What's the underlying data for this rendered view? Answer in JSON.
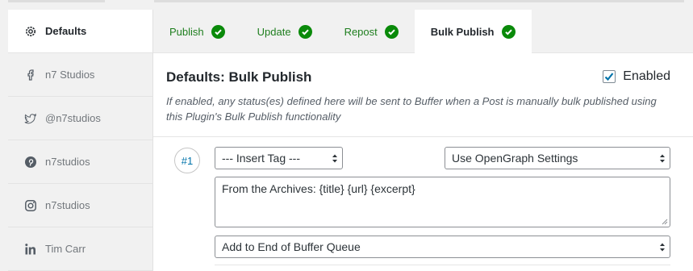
{
  "sidebar": {
    "items": [
      {
        "label": "Defaults",
        "icon": "gear-icon",
        "active": true
      },
      {
        "label": "n7 Studios",
        "icon": "facebook-icon",
        "active": false
      },
      {
        "label": "@n7studios",
        "icon": "twitter-icon",
        "active": false
      },
      {
        "label": "n7studios",
        "icon": "pinterest-icon",
        "active": false
      },
      {
        "label": "n7studios",
        "icon": "instagram-icon",
        "active": false
      },
      {
        "label": "Tim Carr",
        "icon": "linkedin-icon",
        "active": false
      }
    ]
  },
  "tabs": [
    {
      "label": "Publish",
      "icon": "check-circle-icon"
    },
    {
      "label": "Update",
      "icon": "check-circle-icon"
    },
    {
      "label": "Repost",
      "icon": "check-circle-icon"
    },
    {
      "label": "Bulk Publish",
      "icon": "check-circle-icon",
      "active": true
    }
  ],
  "panel": {
    "title": "Defaults: Bulk Publish",
    "enabled_label": "Enabled",
    "enabled_checked": true,
    "description": "If enabled, any status(es) defined here will be sent to Buffer when a Post is manually bulk published using this Plugin's Bulk Publish functionality"
  },
  "status": {
    "number": "#1",
    "tag_select": "--- Insert Tag ---",
    "image_select": "Use OpenGraph Settings",
    "text": "From the Archives: {title} {url} {excerpt}",
    "queue_select": "Add to End of Buffer Queue"
  },
  "colors": {
    "accent": "#0073aa",
    "success": "#0a8a0a",
    "tab_text": "#1e7e1e"
  }
}
